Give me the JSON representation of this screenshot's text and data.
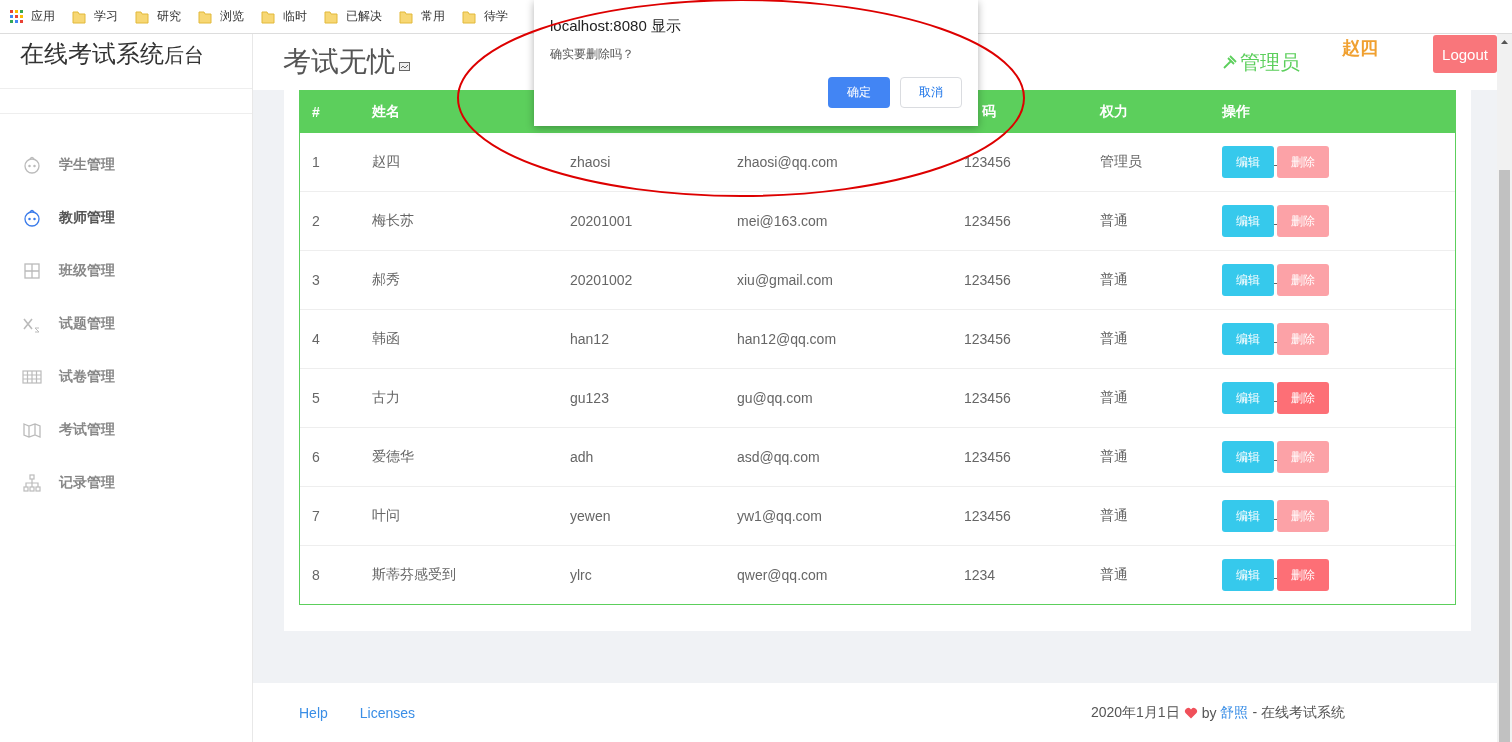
{
  "bookmarks_bar": {
    "items": [
      {
        "label": "应用",
        "kind": "apps"
      },
      {
        "label": "学习",
        "kind": "folder"
      },
      {
        "label": "研究",
        "kind": "folder"
      },
      {
        "label": "浏览",
        "kind": "folder"
      },
      {
        "label": "临时",
        "kind": "folder"
      },
      {
        "label": "已解决",
        "kind": "folder"
      },
      {
        "label": "常用",
        "kind": "folder"
      },
      {
        "label": "待学",
        "kind": "folder"
      }
    ]
  },
  "sidebar": {
    "title": "在线考试系统",
    "title_suffix": "后台",
    "items": [
      {
        "label": "学生管理",
        "selected": false
      },
      {
        "label": "教师管理",
        "selected": true
      },
      {
        "label": "班级管理",
        "selected": false
      },
      {
        "label": "试题管理",
        "selected": false
      },
      {
        "label": "试卷管理",
        "selected": false
      },
      {
        "label": "考试管理",
        "selected": false
      },
      {
        "label": "记录管理",
        "selected": false
      }
    ]
  },
  "header": {
    "title": "考试无忧",
    "role": "管理员",
    "user": "赵四",
    "logout": "Logout"
  },
  "table": {
    "columns": [
      "#",
      "姓名",
      "",
      "",
      "码",
      "权力",
      "操作"
    ],
    "rows": [
      {
        "cells": [
          "1",
          "赵四",
          "zhaosi",
          "zhaosi@qq.com",
          "123456",
          "管理员"
        ],
        "edit": "编辑",
        "delete": "删除",
        "delete_disabled": true
      },
      {
        "cells": [
          "2",
          "梅长苏",
          "20201001",
          "mei@163.com",
          "123456",
          "普通"
        ],
        "edit": "编辑",
        "delete": "删除",
        "delete_disabled": true
      },
      {
        "cells": [
          "3",
          "郝秀",
          "20201002",
          "xiu@gmail.com",
          "123456",
          "普通"
        ],
        "edit": "编辑",
        "delete": "删除",
        "delete_disabled": true
      },
      {
        "cells": [
          "4",
          "韩函",
          "han12",
          "han12@qq.com",
          "123456",
          "普通"
        ],
        "edit": "编辑",
        "delete": "删除",
        "delete_disabled": true
      },
      {
        "cells": [
          "5",
          "古力",
          "gu123",
          "gu@qq.com",
          "123456",
          "普通"
        ],
        "edit": "编辑",
        "delete": "删除",
        "delete_disabled": false
      },
      {
        "cells": [
          "6",
          "爱德华",
          "adh",
          "asd@qq.com",
          "123456",
          "普通"
        ],
        "edit": "编辑",
        "delete": "删除",
        "delete_disabled": true
      },
      {
        "cells": [
          "7",
          "叶问",
          "yewen",
          "yw1@qq.com",
          "123456",
          "普通"
        ],
        "edit": "编辑",
        "delete": "删除",
        "delete_disabled": true
      },
      {
        "cells": [
          "8",
          "斯蒂芬感受到",
          "ylrc",
          "qwer@qq.com",
          "1234",
          "普通"
        ],
        "edit": "编辑",
        "delete": "删除",
        "delete_disabled": false
      }
    ]
  },
  "footer": {
    "links": [
      "Help",
      "Licenses"
    ],
    "date": "2020年1月1日",
    "by": "by",
    "author": "舒照",
    "tail": "- 在线考试系统"
  },
  "dialog": {
    "title": "localhost:8080 显示",
    "message": "确实要删除吗？",
    "buttons": [
      {
        "label": "确定",
        "kind": "primary"
      },
      {
        "label": "取消",
        "kind": "secondary"
      }
    ]
  }
}
